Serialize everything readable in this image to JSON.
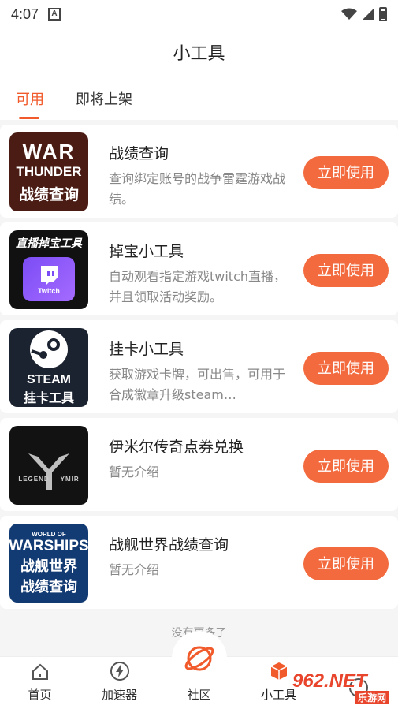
{
  "status_bar": {
    "time": "4:07",
    "app_icon_letter": "A"
  },
  "header": {
    "title": "小工具"
  },
  "tabs": [
    {
      "label": "可用",
      "active": true
    },
    {
      "label": "即将上架",
      "active": false
    }
  ],
  "tools": [
    {
      "title": "战绩查询",
      "description": "查询绑定账号的战争雷霆游戏战绩。",
      "button": "立即使用",
      "thumb": {
        "line1": "WAR",
        "line2": "THUNDER",
        "line3": "战绩查询",
        "bg": "#4a1c14"
      }
    },
    {
      "title": "掉宝小工具",
      "description": "自动观看指定游戏twitch直播，并且领取活动奖励。",
      "button": "立即使用",
      "thumb": {
        "line1": "直播掉宝工具",
        "line2": "Twitch",
        "bg": "#111111"
      }
    },
    {
      "title": "挂卡小工具",
      "description": "获取游戏卡牌，可出售，可用于合成徽章升级steam…",
      "button": "立即使用",
      "thumb": {
        "line1": "STEAM",
        "line2": "挂卡工具",
        "bg": "#1b2230"
      }
    },
    {
      "title": "伊米尔传奇点券兑换",
      "description": "暂无介绍",
      "button": "立即使用",
      "thumb": {
        "line1": "LEGEND",
        "line2": "YMIR",
        "bg": "#121212"
      }
    },
    {
      "title": "战舰世界战绩查询",
      "description": "暂无介绍",
      "button": "立即使用",
      "thumb": {
        "line1": "WORLD OF",
        "line2": "WARSHIPS",
        "line3": "战舰世界",
        "line4": "战绩查询",
        "bg": "#123a73"
      }
    }
  ],
  "list_footer": "没有更多了",
  "bottom_nav": [
    {
      "label": "首页",
      "icon": "home-icon"
    },
    {
      "label": "加速器",
      "icon": "bolt-icon"
    },
    {
      "label": "社区",
      "icon": "planet-icon"
    },
    {
      "label": "小工具",
      "icon": "cube-icon",
      "active": true
    },
    {
      "label": "",
      "icon": "profile-icon"
    }
  ],
  "watermark": {
    "text": "962.NET",
    "sub": "乐游网"
  },
  "colors": {
    "accent": "#f15a2b",
    "button": "#f26a3d"
  }
}
